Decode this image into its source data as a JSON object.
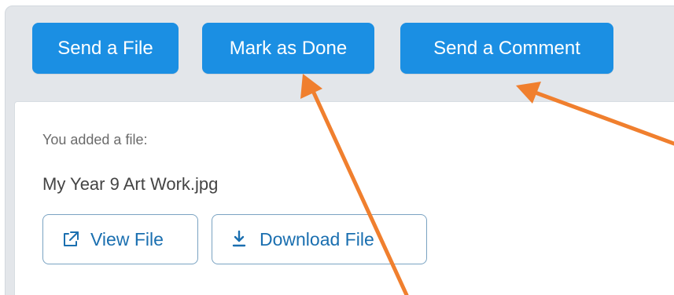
{
  "toolbar": {
    "send_file_label": "Send a File",
    "mark_done_label": "Mark as Done",
    "send_comment_label": "Send a Comment"
  },
  "file_card": {
    "added_text": "You added a file:",
    "file_name": "My Year 9 Art Work.jpg",
    "view_label": "View File",
    "download_label": "Download File"
  },
  "colors": {
    "primary_button": "#1b8fe3",
    "panel_bg": "#e3e6ea",
    "outline_button_text": "#1a6fb0",
    "annotation_arrow": "#f07f2e"
  },
  "icons": {
    "view": "external-link-icon",
    "download": "download-icon"
  }
}
